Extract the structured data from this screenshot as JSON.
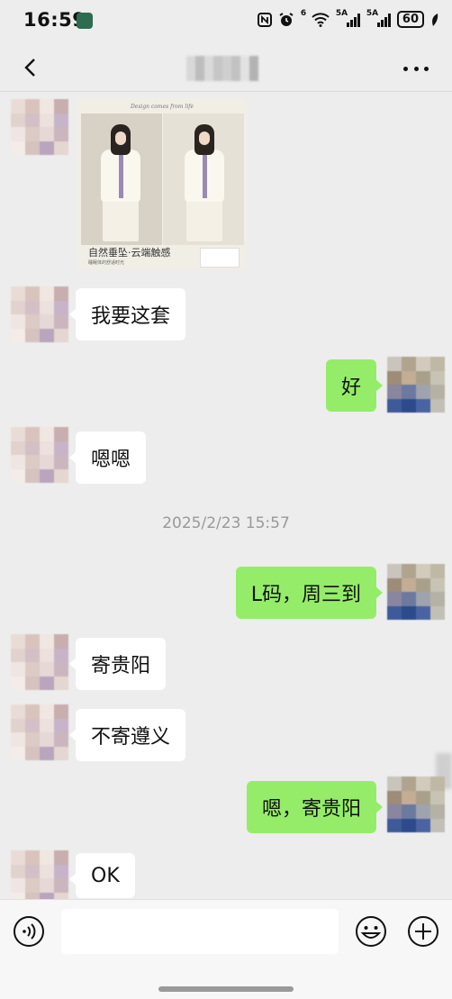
{
  "status_bar": {
    "time": "16:59",
    "sig1_tag": "5A",
    "sig2_tag": "5A",
    "wifi_tag": "6",
    "battery": "60"
  },
  "header": {
    "back_icon": "chevron-left-icon",
    "more_icon": "more-dots-icon"
  },
  "shared_product": {
    "tagline": "Design comes from life",
    "caption": "自然垂坠·云端触感",
    "sub": "睡眠体的舒适时光"
  },
  "messages": [
    {
      "side": "left",
      "text": "我要这套"
    },
    {
      "side": "right",
      "text": "好"
    },
    {
      "side": "left",
      "text": "嗯嗯"
    },
    {
      "side": "right",
      "text": "L码，周三到"
    },
    {
      "side": "left",
      "text": "寄贵阳"
    },
    {
      "side": "left",
      "text": "不寄遵义"
    },
    {
      "side": "right",
      "text": "嗯，寄贵阳"
    },
    {
      "side": "left",
      "text": "OK"
    }
  ],
  "timestamp": "2025/2/23 15:57",
  "input_bar": {
    "placeholder": "",
    "voice_icon": "voice-icon",
    "emoji_icon": "emoji-icon",
    "plus_icon": "plus-icon"
  },
  "colors": {
    "background": "#ededed",
    "bubble_self": "#95ec69",
    "bubble_other": "#ffffff",
    "timestamp": "#999999"
  }
}
